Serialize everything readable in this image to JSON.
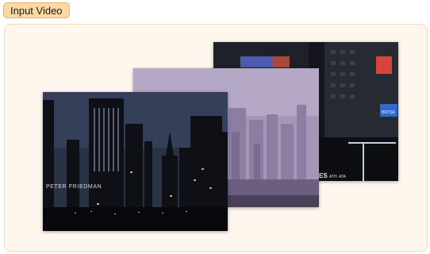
{
  "section": {
    "label": "Input Video"
  },
  "frames": {
    "caption": "PETER FRIEDMAN",
    "signs": [
      "ES",
      "ATH",
      "ATA",
      "BRYSA"
    ]
  },
  "colors": {
    "tag_bg": "#fcd9a2",
    "tag_border": "#e9b26b",
    "panel_bg": "#fff6ee",
    "panel_border": "#f2d8b8"
  }
}
